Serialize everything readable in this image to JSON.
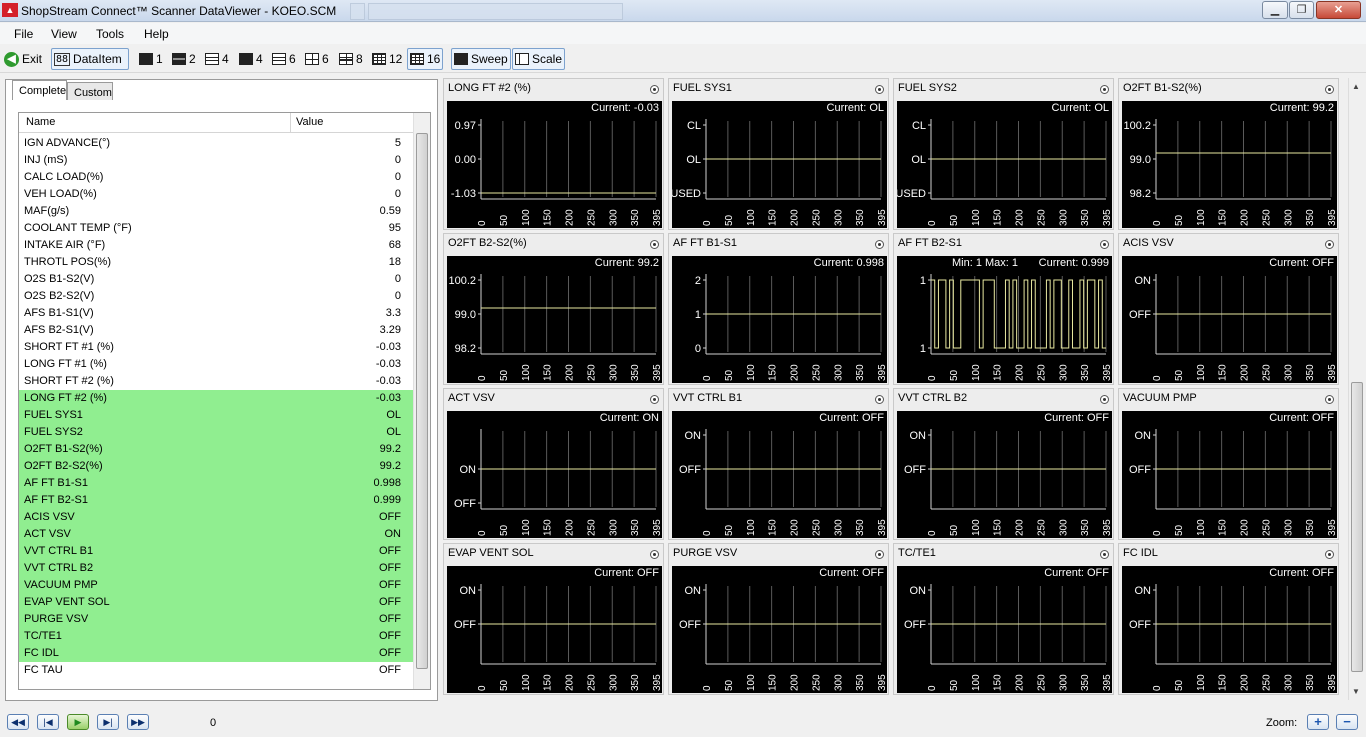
{
  "window": {
    "title": "ShopStream Connect™ Scanner DataViewer - KOEO.SCM",
    "icon": "app-logo-icon",
    "controls": [
      "minimize-icon",
      "maximize-icon",
      "close-icon"
    ]
  },
  "menu": [
    "File",
    "View",
    "Tools",
    "Help"
  ],
  "toolbar": {
    "exit_label": "Exit",
    "dataitem_label": "DataItem",
    "layout_buttons": [
      "1",
      "2",
      "4",
      "4",
      "6",
      "6",
      "8",
      "12",
      "16"
    ],
    "sweep_label": "Sweep",
    "scale_label": "Scale"
  },
  "left_panel": {
    "tabs": [
      "Complete",
      "Custom"
    ],
    "columns": [
      "Name",
      "Value"
    ],
    "rows": [
      {
        "name": "IGN ADVANCE(°)",
        "value": "5",
        "selected": false
      },
      {
        "name": "INJ (mS)",
        "value": "0",
        "selected": false
      },
      {
        "name": "CALC LOAD(%)",
        "value": "0",
        "selected": false
      },
      {
        "name": "VEH LOAD(%)",
        "value": "0",
        "selected": false
      },
      {
        "name": "MAF(g/s)",
        "value": "0.59",
        "selected": false
      },
      {
        "name": "COOLANT TEMP (°F)",
        "value": "95",
        "selected": false
      },
      {
        "name": "INTAKE AIR (°F)",
        "value": "68",
        "selected": false
      },
      {
        "name": "THROTL POS(%)",
        "value": "18",
        "selected": false
      },
      {
        "name": "O2S B1-S2(V)",
        "value": "0",
        "selected": false
      },
      {
        "name": "O2S B2-S2(V)",
        "value": "0",
        "selected": false
      },
      {
        "name": "AFS B1-S1(V)",
        "value": "3.3",
        "selected": false
      },
      {
        "name": "AFS B2-S1(V)",
        "value": "3.29",
        "selected": false
      },
      {
        "name": "SHORT FT #1 (%)",
        "value": "-0.03",
        "selected": false
      },
      {
        "name": "LONG FT #1 (%)",
        "value": "-0.03",
        "selected": false
      },
      {
        "name": "SHORT FT #2 (%)",
        "value": "-0.03",
        "selected": false
      },
      {
        "name": "LONG FT #2 (%)",
        "value": "-0.03",
        "selected": true
      },
      {
        "name": "FUEL SYS1",
        "value": "OL",
        "selected": true
      },
      {
        "name": "FUEL SYS2",
        "value": "OL",
        "selected": true
      },
      {
        "name": "O2FT B1-S2(%)",
        "value": "99.2",
        "selected": true
      },
      {
        "name": "O2FT B2-S2(%)",
        "value": "99.2",
        "selected": true
      },
      {
        "name": "AF FT B1-S1",
        "value": "0.998",
        "selected": true
      },
      {
        "name": "AF FT B2-S1",
        "value": "0.999",
        "selected": true
      },
      {
        "name": "ACIS VSV",
        "value": "OFF",
        "selected": true
      },
      {
        "name": "ACT VSV",
        "value": "ON",
        "selected": true
      },
      {
        "name": "VVT CTRL B1",
        "value": "OFF",
        "selected": true
      },
      {
        "name": "VVT CTRL B2",
        "value": "OFF",
        "selected": true
      },
      {
        "name": "VACUUM PMP",
        "value": "OFF",
        "selected": true
      },
      {
        "name": "EVAP VENT SOL",
        "value": "OFF",
        "selected": true
      },
      {
        "name": "PURGE VSV",
        "value": "OFF",
        "selected": true
      },
      {
        "name": "TC/TE1",
        "value": "OFF",
        "selected": true
      },
      {
        "name": "FC IDL",
        "value": "OFF",
        "selected": true
      },
      {
        "name": "FC TAU",
        "value": "OFF",
        "selected": false
      }
    ]
  },
  "graph_x_ticks": [
    "0",
    "50",
    "100",
    "150",
    "200",
    "250",
    "300",
    "350",
    "395"
  ],
  "graphs": [
    {
      "title": "LONG FT #2 (%)",
      "current": "Current: -0.03",
      "y_labels": [
        "0.97",
        "0.00",
        "-1.03"
      ],
      "trace_level": "-1.03",
      "kind": "flat"
    },
    {
      "title": "FUEL SYS1",
      "current": "Current: OL",
      "y_labels": [
        "CL",
        "OL",
        "UNUSED"
      ],
      "trace_level": "OL",
      "kind": "flat"
    },
    {
      "title": "FUEL SYS2",
      "current": "Current: OL",
      "y_labels": [
        "CL",
        "OL",
        "UNUSED"
      ],
      "trace_level": "OL",
      "kind": "flat"
    },
    {
      "title": "O2FT B1-S2(%)",
      "current": "Current: 99.2",
      "y_labels": [
        "100.2",
        "99.0",
        "98.2"
      ],
      "trace_level": "99.2",
      "kind": "flat"
    },
    {
      "title": "O2FT B2-S2(%)",
      "current": "Current: 99.2",
      "y_labels": [
        "100.2",
        "99.0",
        "98.2"
      ],
      "trace_level": "99.2",
      "kind": "flat"
    },
    {
      "title": "AF FT B1-S1",
      "current": "Current: 0.998",
      "y_labels": [
        "2",
        "1",
        "0"
      ],
      "trace_level": "1",
      "kind": "flat"
    },
    {
      "title": "AF FT B2-S1",
      "current": "Current: 0.999",
      "minmax": "Min: 1     Max: 1",
      "y_labels": [
        "1",
        "",
        "1"
      ],
      "trace_level": "toggle",
      "kind": "toggle"
    },
    {
      "title": "ACIS VSV",
      "current": "Current: OFF",
      "y_labels": [
        "ON",
        "OFF",
        ""
      ],
      "trace_level": "OFF",
      "kind": "flat"
    },
    {
      "title": "ACT VSV",
      "current": "Current: ON",
      "y_labels": [
        "",
        "ON",
        "OFF"
      ],
      "trace_level": "ON",
      "kind": "flat"
    },
    {
      "title": "VVT CTRL B1",
      "current": "Current: OFF",
      "y_labels": [
        "ON",
        "OFF",
        ""
      ],
      "trace_level": "OFF",
      "kind": "flat"
    },
    {
      "title": "VVT CTRL B2",
      "current": "Current: OFF",
      "y_labels": [
        "ON",
        "OFF",
        ""
      ],
      "trace_level": "OFF",
      "kind": "flat"
    },
    {
      "title": "VACUUM PMP",
      "current": "Current: OFF",
      "y_labels": [
        "ON",
        "OFF",
        ""
      ],
      "trace_level": "OFF",
      "kind": "flat"
    },
    {
      "title": "EVAP VENT SOL",
      "current": "Current: OFF",
      "y_labels": [
        "ON",
        "OFF",
        ""
      ],
      "trace_level": "OFF",
      "kind": "flat"
    },
    {
      "title": "PURGE VSV",
      "current": "Current: OFF",
      "y_labels": [
        "ON",
        "OFF",
        ""
      ],
      "trace_level": "OFF",
      "kind": "flat"
    },
    {
      "title": "TC/TE1",
      "current": "Current: OFF",
      "y_labels": [
        "ON",
        "OFF",
        ""
      ],
      "trace_level": "OFF",
      "kind": "flat"
    },
    {
      "title": "FC IDL",
      "current": "Current: OFF",
      "y_labels": [
        "ON",
        "OFF",
        ""
      ],
      "trace_level": "OFF",
      "kind": "flat"
    }
  ],
  "colors": {
    "trace": "#e8e8a0",
    "graph_bg": "#000000",
    "selected_row": "#90ee90"
  },
  "status": {
    "counter": "0",
    "zoom_label": "Zoom:",
    "playback": [
      "first-frame-icon",
      "prev-frame-icon",
      "play-icon",
      "next-frame-icon",
      "last-frame-icon"
    ],
    "zoom_buttons": [
      "zoom-in-icon",
      "zoom-out-icon"
    ]
  }
}
